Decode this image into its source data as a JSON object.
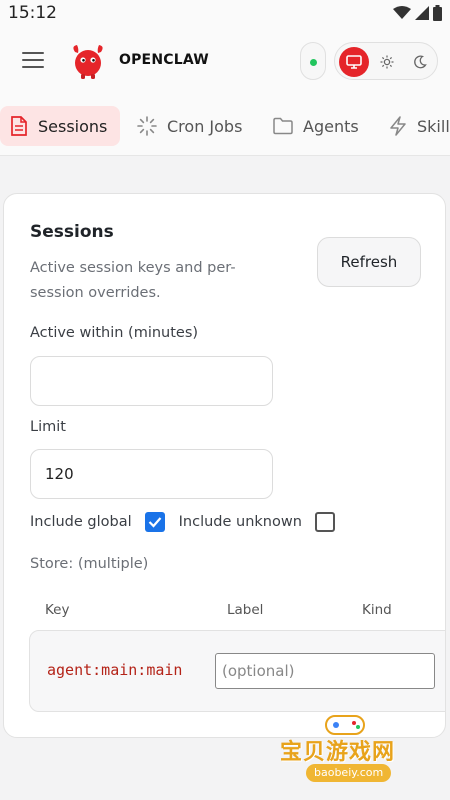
{
  "status_bar": {
    "time": "15:12"
  },
  "header": {
    "menu_icon": "hamburger-icon",
    "logo_icon": "red-lobster-mascot",
    "brand": "OPENCLAW",
    "connection_status_color": "#22c55e",
    "theme_options": [
      "monitor-icon",
      "sun-icon",
      "moon-icon"
    ],
    "active_theme": "monitor-icon"
  },
  "tabs": [
    {
      "label": "Sessions",
      "icon": "document-icon",
      "active": true
    },
    {
      "label": "Cron Jobs",
      "icon": "loader-icon",
      "active": false
    },
    {
      "label": "Agents",
      "icon": "folder-icon",
      "active": false
    },
    {
      "label": "Skill",
      "icon": "lightning-icon",
      "active": false
    }
  ],
  "sessions_panel": {
    "title": "Sessions",
    "subtitle": "Active session keys and per-session overrides.",
    "refresh_label": "Refresh",
    "active_within_label": "Active within (minutes)",
    "active_within_value": "",
    "limit_label": "Limit",
    "limit_value": "120",
    "include_global_label": "Include global",
    "include_global_checked": true,
    "include_unknown_label": "Include unknown",
    "include_unknown_checked": false,
    "store_text": "Store: (multiple)",
    "table": {
      "columns": [
        "Key",
        "Label",
        "Kind"
      ],
      "rows": [
        {
          "key": "agent:main:main",
          "label_value": "",
          "label_placeholder": "(optional)"
        }
      ]
    }
  },
  "watermark": {
    "text": "宝贝游戏网",
    "url": "baobeiy.com"
  },
  "colors": {
    "accent": "#e5252a",
    "active_tab_bg": "#fde4e4",
    "key_text": "#b42318",
    "checkbox": "#1a73e8"
  }
}
